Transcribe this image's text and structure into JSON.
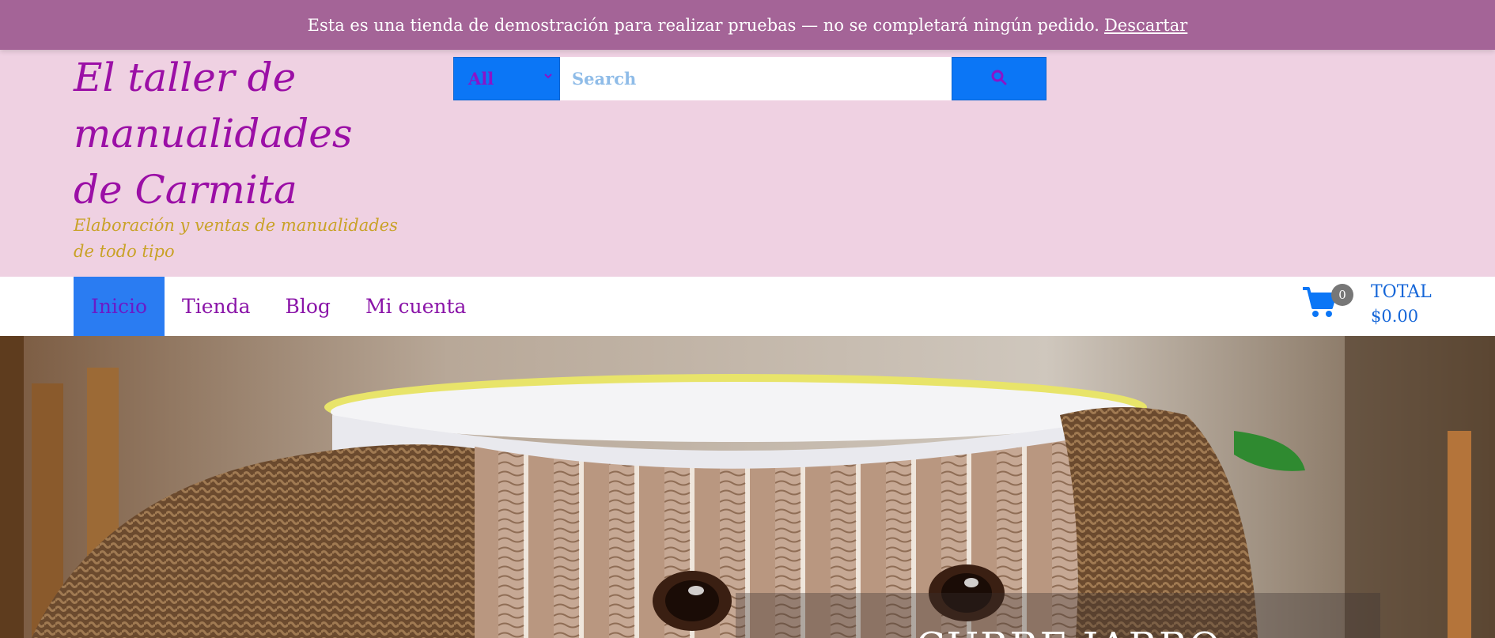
{
  "notice": {
    "text": "Esta es una tienda de demostración para realizar pruebas — no se completará ningún pedido.",
    "dismiss": "Descartar"
  },
  "site": {
    "title_line1": "El taller de",
    "title_line2": "manualidades",
    "title_line3": "de Carmita",
    "tagline_line1": "Elaboración y ventas de manualidades",
    "tagline_line2": "de todo tipo"
  },
  "search": {
    "category": "All",
    "placeholder": "Search",
    "button_icon": "search-icon"
  },
  "nav": {
    "items": [
      {
        "label": "Inicio"
      },
      {
        "label": "Tienda"
      },
      {
        "label": "Blog"
      },
      {
        "label": "Mi cuenta"
      }
    ]
  },
  "cart": {
    "count": "0",
    "total_label": "TOTAL",
    "total_value": "$0.00"
  },
  "hero": {
    "title": "CUBRE JARRO"
  },
  "colors": {
    "notice_bg": "#a46497",
    "header_bg": "#efd1e2",
    "brand_purple": "#9b0fa6",
    "tagline_gold": "#c9a227",
    "accent_blue": "#0b76f6"
  }
}
